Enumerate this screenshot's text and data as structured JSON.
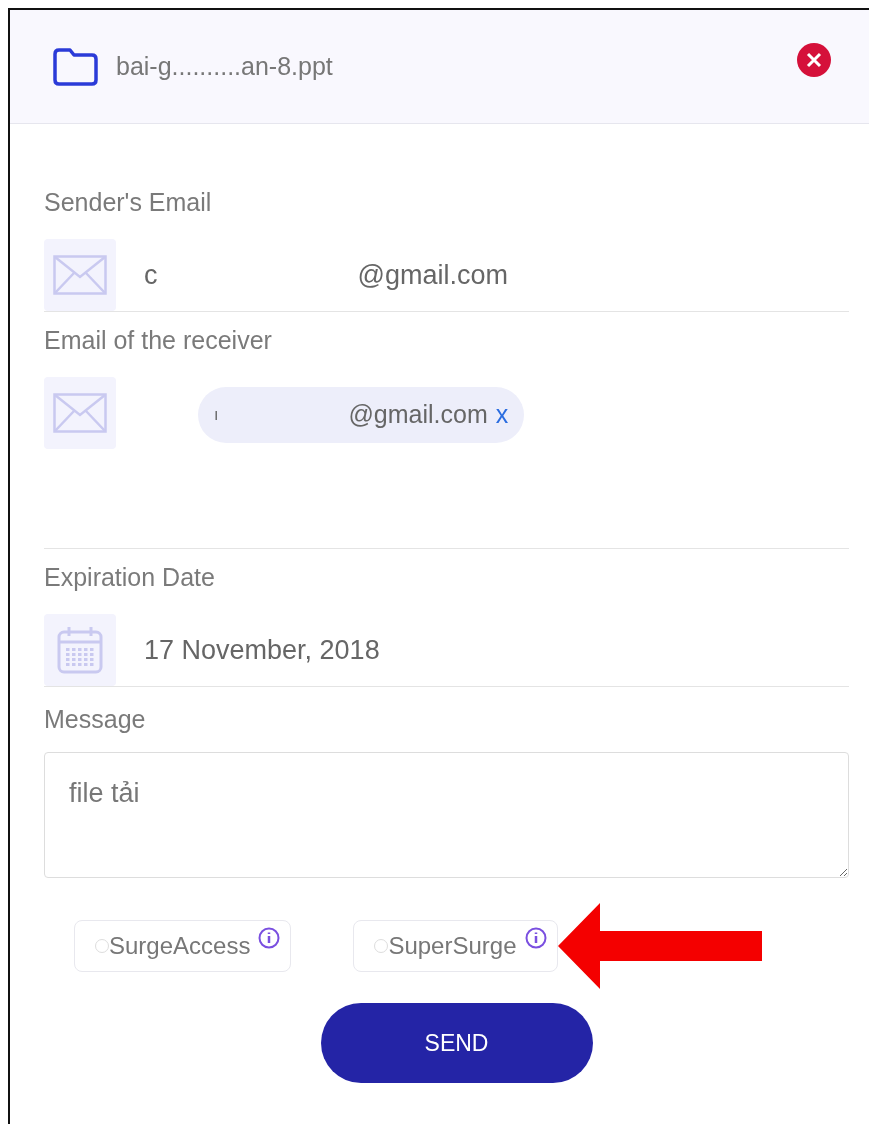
{
  "header": {
    "file_name": "bai-g..........an-8.ppt"
  },
  "sender": {
    "label": "Sender's Email",
    "value_start": "c",
    "value_end": "@gmail.com"
  },
  "receiver": {
    "label": "Email of the receiver",
    "chips": [
      {
        "value_start": "ı",
        "value_end": "@gmail.com",
        "remove": "x"
      }
    ]
  },
  "expiration": {
    "label": "Expiration Date",
    "value": "17 November, 2018"
  },
  "message": {
    "label": "Message",
    "value": "file tải"
  },
  "options": [
    {
      "label": "SurgeAccess",
      "selected": false
    },
    {
      "label": "SuperSurge",
      "selected": false
    }
  ],
  "send_button": "SEND"
}
